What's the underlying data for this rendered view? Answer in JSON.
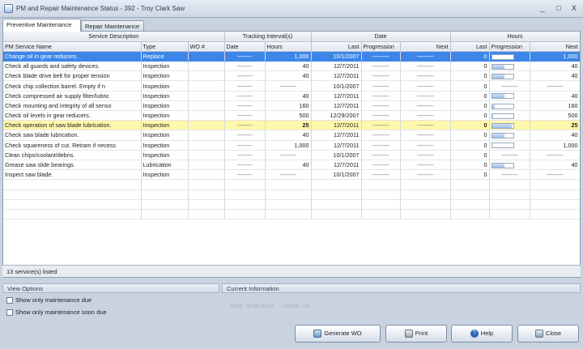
{
  "window": {
    "title": "PM and Repair Maintenance Status - 392 - Troy Clark Saw",
    "controls": [
      "_",
      "□",
      "X"
    ]
  },
  "tabs": [
    {
      "label": "Preventive Maintenance",
      "active": true
    },
    {
      "label": "Repair Maintenance",
      "active": false
    }
  ],
  "grid": {
    "group_headers": {
      "service": "Service Description",
      "tracking": "Tracking Interval(s)",
      "date": "Date",
      "hours": "Hours"
    },
    "columns": [
      "PM Service Name",
      "Type",
      "WO #",
      "Date",
      "Hours",
      "Last",
      "Progression",
      "Next",
      "Last",
      "Progression",
      "Next"
    ],
    "rows": [
      {
        "name": "Change oil in gear reducers.",
        "type": "Replace",
        "wo": "",
        "t_date": "----------",
        "t_hours": "1,000",
        "d_last": "10/1/2007",
        "d_prog": "-----------",
        "d_next": "-----------",
        "h_last": "0",
        "h_prog": 0.0,
        "h_next": "1,000",
        "selected": true,
        "highlight": false
      },
      {
        "name": "Check all guards and safety devices.",
        "type": "Inspection",
        "wo": "",
        "t_date": "----------",
        "t_hours": "40",
        "d_last": "12/7/2011",
        "d_prog": "-----------",
        "d_next": "-----------",
        "h_last": "0",
        "h_prog": 0.6,
        "h_next": "40",
        "selected": false,
        "highlight": false
      },
      {
        "name": "Check blade drive belt for proper tension",
        "type": "Inspection",
        "wo": "",
        "t_date": "----------",
        "t_hours": "40",
        "d_last": "12/7/2011",
        "d_prog": "-----------",
        "d_next": "-----------",
        "h_last": "0",
        "h_prog": 0.6,
        "h_next": "40",
        "selected": false,
        "highlight": false
      },
      {
        "name": "Check chip collection barrel.  Empty if n",
        "type": "Inspection",
        "wo": "",
        "t_date": "----------",
        "t_hours": "----------",
        "d_last": "10/1/2007",
        "d_prog": "-----------",
        "d_next": "-----------",
        "h_last": "0",
        "h_prog": -1,
        "h_next": "-----------",
        "selected": false,
        "highlight": false
      },
      {
        "name": "Check compressed air supply filter/lubric",
        "type": "Inspection",
        "wo": "",
        "t_date": "----------",
        "t_hours": "40",
        "d_last": "12/7/2011",
        "d_prog": "-----------",
        "d_next": "-----------",
        "h_last": "0",
        "h_prog": 0.6,
        "h_next": "40",
        "selected": false,
        "highlight": false
      },
      {
        "name": "Check mounting and integrity of all senso",
        "type": "Inspection",
        "wo": "",
        "t_date": "----------",
        "t_hours": "160",
        "d_last": "12/7/2011",
        "d_prog": "-----------",
        "d_next": "-----------",
        "h_last": "0",
        "h_prog": 0.15,
        "h_next": "160",
        "selected": false,
        "highlight": false
      },
      {
        "name": "Check oil levels in gear reducers.",
        "type": "Inspection",
        "wo": "",
        "t_date": "----------",
        "t_hours": "500",
        "d_last": "12/29/2007",
        "d_prog": "-----------",
        "d_next": "-----------",
        "h_last": "0",
        "h_prog": 0.05,
        "h_next": "500",
        "selected": false,
        "highlight": false
      },
      {
        "name": "Check operation of saw blade lubrication.",
        "type": "Inspection",
        "wo": "",
        "t_date": "----------",
        "t_hours": "25",
        "d_last": "12/7/2011",
        "d_prog": "-----------",
        "d_next": "-----------",
        "h_last": "0",
        "h_prog": 0.96,
        "h_next": "25",
        "selected": false,
        "highlight": true
      },
      {
        "name": "Check saw blade lubrication.",
        "type": "Inspection",
        "wo": "",
        "t_date": "----------",
        "t_hours": "40",
        "d_last": "12/7/2011",
        "d_prog": "-----------",
        "d_next": "-----------",
        "h_last": "0",
        "h_prog": 0.6,
        "h_next": "40",
        "selected": false,
        "highlight": false
      },
      {
        "name": "Check squareness of cut. Retram if necess",
        "type": "Inspection",
        "wo": "",
        "t_date": "----------",
        "t_hours": "1,000",
        "d_last": "12/7/2011",
        "d_prog": "-----------",
        "d_next": "-----------",
        "h_last": "0",
        "h_prog": 0.0,
        "h_next": "1,000",
        "selected": false,
        "highlight": false
      },
      {
        "name": "Clean chips/coolant/debris.",
        "type": "Inspection",
        "wo": "",
        "t_date": "----------",
        "t_hours": "----------",
        "d_last": "10/1/2007",
        "d_prog": "-----------",
        "d_next": "-----------",
        "h_last": "0",
        "h_prog": -1,
        "h_next": "-----------",
        "selected": false,
        "highlight": false
      },
      {
        "name": "Grease saw slide bearings.",
        "type": "Lubrication",
        "wo": "",
        "t_date": "----------",
        "t_hours": "40",
        "d_last": "12/7/2011",
        "d_prog": "-----------",
        "d_next": "-----------",
        "h_last": "0",
        "h_prog": 0.6,
        "h_next": "40",
        "selected": false,
        "highlight": false
      },
      {
        "name": "Inspect saw blade.",
        "type": "Inspection",
        "wo": "",
        "t_date": "----------",
        "t_hours": "----------",
        "d_last": "10/1/2007",
        "d_prog": "-----------",
        "d_next": "-----------",
        "h_last": "0",
        "h_prog": -1,
        "h_next": "-----------",
        "selected": false,
        "highlight": false
      }
    ]
  },
  "status": {
    "text": "13 service(s) listed"
  },
  "view_options": {
    "title": "View Options",
    "options": [
      {
        "label": "Show only maintenance due",
        "checked": false
      },
      {
        "label": "Show only maintenance soon due",
        "checked": false
      }
    ]
  },
  "current_info": {
    "title": "Current Information",
    "date": "Date: 9/18/2014",
    "hours": "Hours: 24"
  },
  "buttons": {
    "generate": "Generate WO",
    "print": "Print",
    "help": "Help",
    "close": "Close"
  },
  "colors": {
    "selection": "#3d86e8",
    "highlight": "#fdf8ab",
    "header": "#e1e6ee"
  }
}
